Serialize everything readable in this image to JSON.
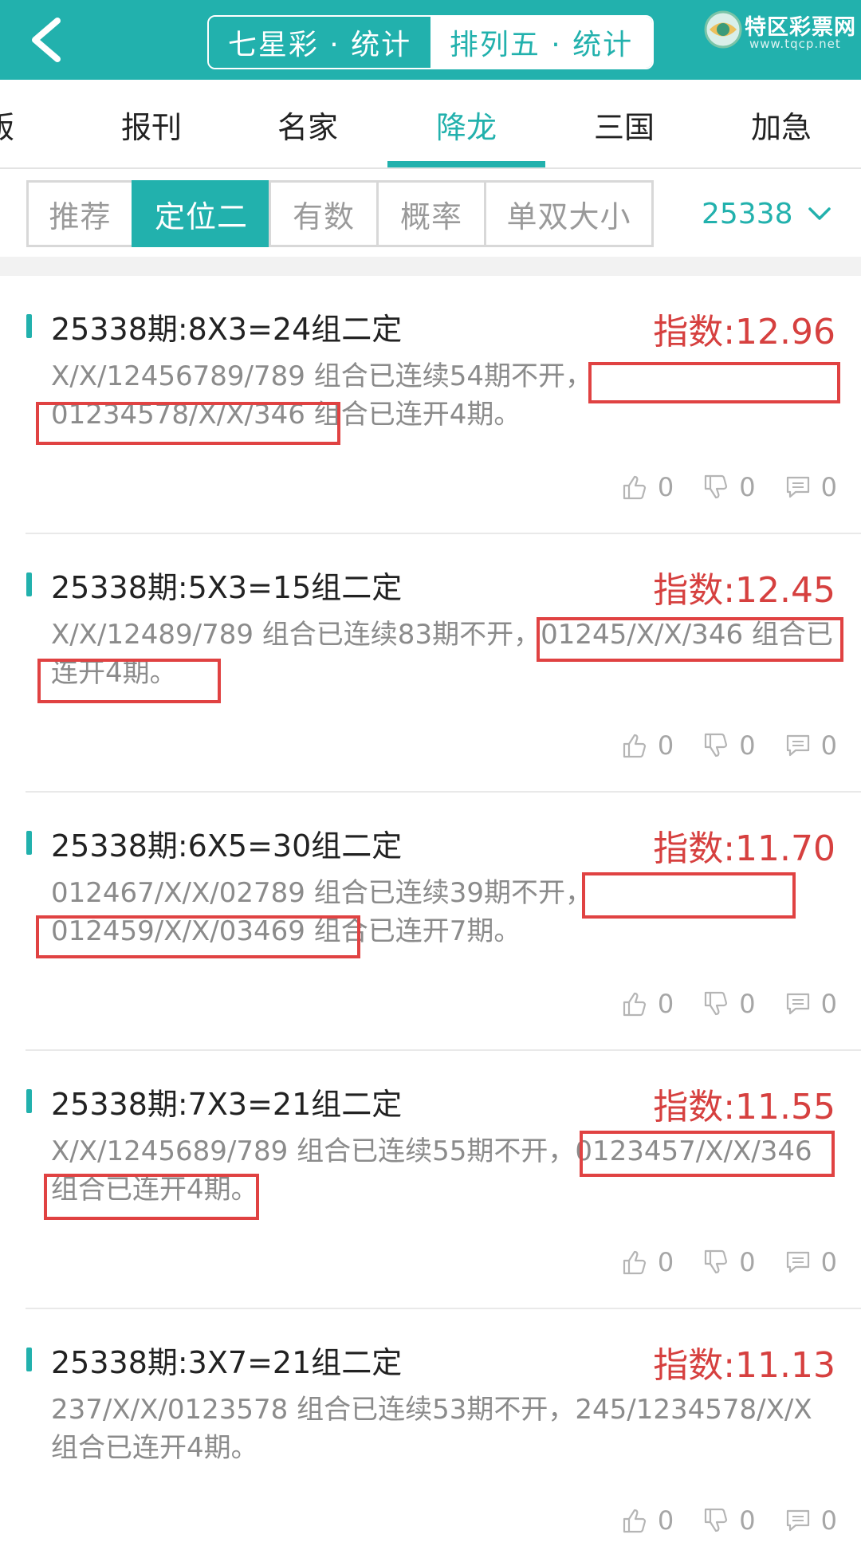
{
  "header": {
    "seg_left": "七星彩 · 统计",
    "seg_right": "排列五 · 统计",
    "logo_text": "特区彩票网",
    "logo_url": "www.tqcp.net",
    "accent_color": "#22b1ad"
  },
  "tabs": [
    {
      "label": "版"
    },
    {
      "label": "报刊"
    },
    {
      "label": "名家"
    },
    {
      "label": "降龙"
    },
    {
      "label": "三国"
    },
    {
      "label": "加急"
    }
  ],
  "subtabs": [
    {
      "label": "推荐"
    },
    {
      "label": "定位二"
    },
    {
      "label": "有数"
    },
    {
      "label": "概率"
    },
    {
      "label": "单双大小"
    }
  ],
  "issue_selector": "25338",
  "cards": [
    {
      "title": "25338期:8X3=24组二定",
      "index": "指数:12.96",
      "desc": "X/X/12456789/789 组合已连续54期不开，01234578/X/X/346 组合已连开4期。",
      "like": "0",
      "dislike": "0",
      "comments": "0"
    },
    {
      "title": "25338期:5X3=15组二定",
      "index": "指数:12.45",
      "desc": "X/X/12489/789 组合已连续83期不开，01245/X/X/346 组合已连开4期。",
      "like": "0",
      "dislike": "0",
      "comments": "0"
    },
    {
      "title": "25338期:6X5=30组二定",
      "index": "指数:11.70",
      "desc": "012467/X/X/02789 组合已连续39期不开，012459/X/X/03469 组合已连开7期。",
      "like": "0",
      "dislike": "0",
      "comments": "0"
    },
    {
      "title": "25338期:7X3=21组二定",
      "index": "指数:11.55",
      "desc": "X/X/1245689/789 组合已连续55期不开，0123457/X/X/346 组合已连开4期。",
      "like": "0",
      "dislike": "0",
      "comments": "0"
    },
    {
      "title": "25338期:3X7=21组二定",
      "index": "指数:11.13",
      "desc": "237/X/X/0123578 组合已连续53期不开，245/1234578/X/X 组合已连开4期。",
      "like": "0",
      "dislike": "0",
      "comments": "0"
    }
  ]
}
